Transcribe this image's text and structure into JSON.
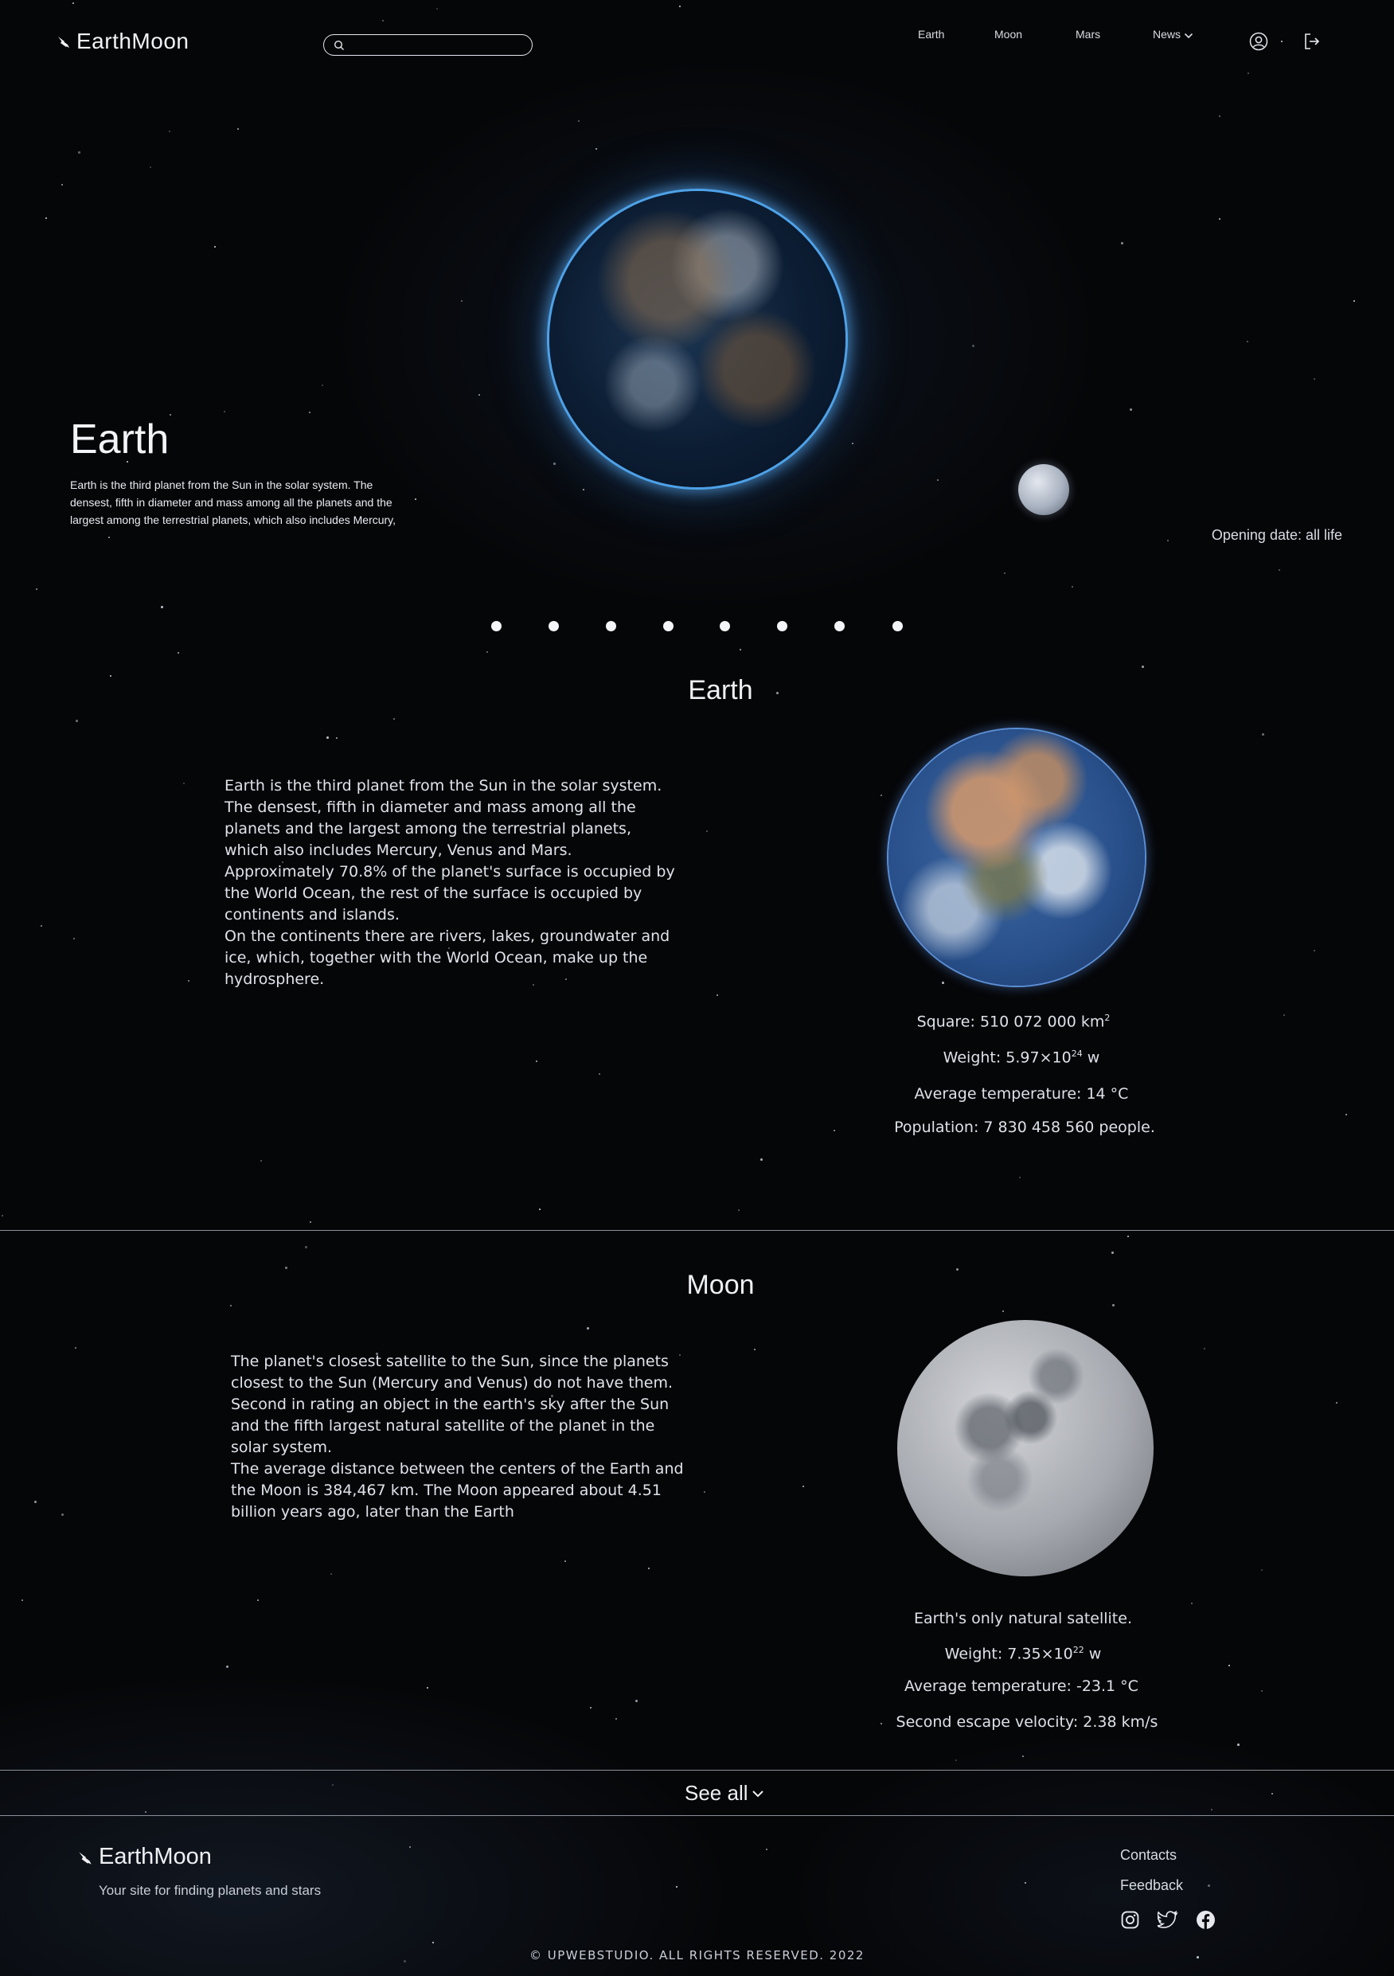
{
  "header": {
    "logo_text": "EarthMoon",
    "search": {
      "placeholder": "",
      "value": ""
    },
    "nav": [
      {
        "label": "Earth"
      },
      {
        "label": "Moon"
      },
      {
        "label": "Mars"
      },
      {
        "label": "News"
      }
    ],
    "icons": [
      "user-circle-icon",
      "logout-icon"
    ]
  },
  "hero": {
    "title": "Earth",
    "description": "Earth is the third planet from the Sun in the solar system. The densest, fifth in diameter and mass among all the planets and the largest among the terrestrial planets, which also includes Mercury,",
    "opening_date": "Opening date: all life",
    "slider": {
      "count": 8,
      "active": 0
    }
  },
  "earth": {
    "title": "Earth",
    "text": "Earth is the third planet from the Sun in the solar system. The densest, fifth in diameter and mass among all the planets and the largest among the terrestrial planets, which also includes Mercury, Venus and Mars.\n Approximately 70.8% of the planet's surface is occupied by the World Ocean, the rest of the surface is occupied by continents and islands.\n On the continents there are rivers, lakes, groundwater and ice, which, together with the World Ocean, make up the hydrosphere.",
    "stats": {
      "square_label": "Square: 510 072 000 km",
      "square_sup": "2",
      "weight_label": "Weight: 5.97×10",
      "weight_sup": "24",
      "weight_unit": " w",
      "temperature": "Average temperature: 14 °C",
      "population": "Population: 7 830 458 560 people."
    }
  },
  "moon": {
    "title": "Moon",
    "text": "The planet's closest satellite to the Sun, since the planets closest to the Sun (Mercury and Venus) do not have them. Second in rating an object in the earth's sky after the Sun and the fifth largest natural satellite of the planet in the solar system.\nThe average distance between the centers of the Earth and the Moon is 384,467 km. The Moon appeared about 4.51 billion years ago, later than the Earth",
    "stats": {
      "satellite": "Earth's only natural satellite.",
      "weight_label": "Weight: 7.35×10",
      "weight_sup": "22",
      "weight_unit": " w",
      "temperature": "Average temperature: -23.1 °C",
      "escape_velocity": "Second escape velocity: 2.38 km/s"
    }
  },
  "see_all": "See all",
  "footer": {
    "logo_text": "EarthMoon",
    "tagline": "Your site for finding planets and stars",
    "links": [
      "Contacts",
      "Feedback"
    ],
    "social": [
      "instagram-icon",
      "twitter-icon",
      "facebook-icon"
    ],
    "copyright": "© UPWEBSTUDIO. ALL RIGHTS RESERVED. 2022"
  }
}
